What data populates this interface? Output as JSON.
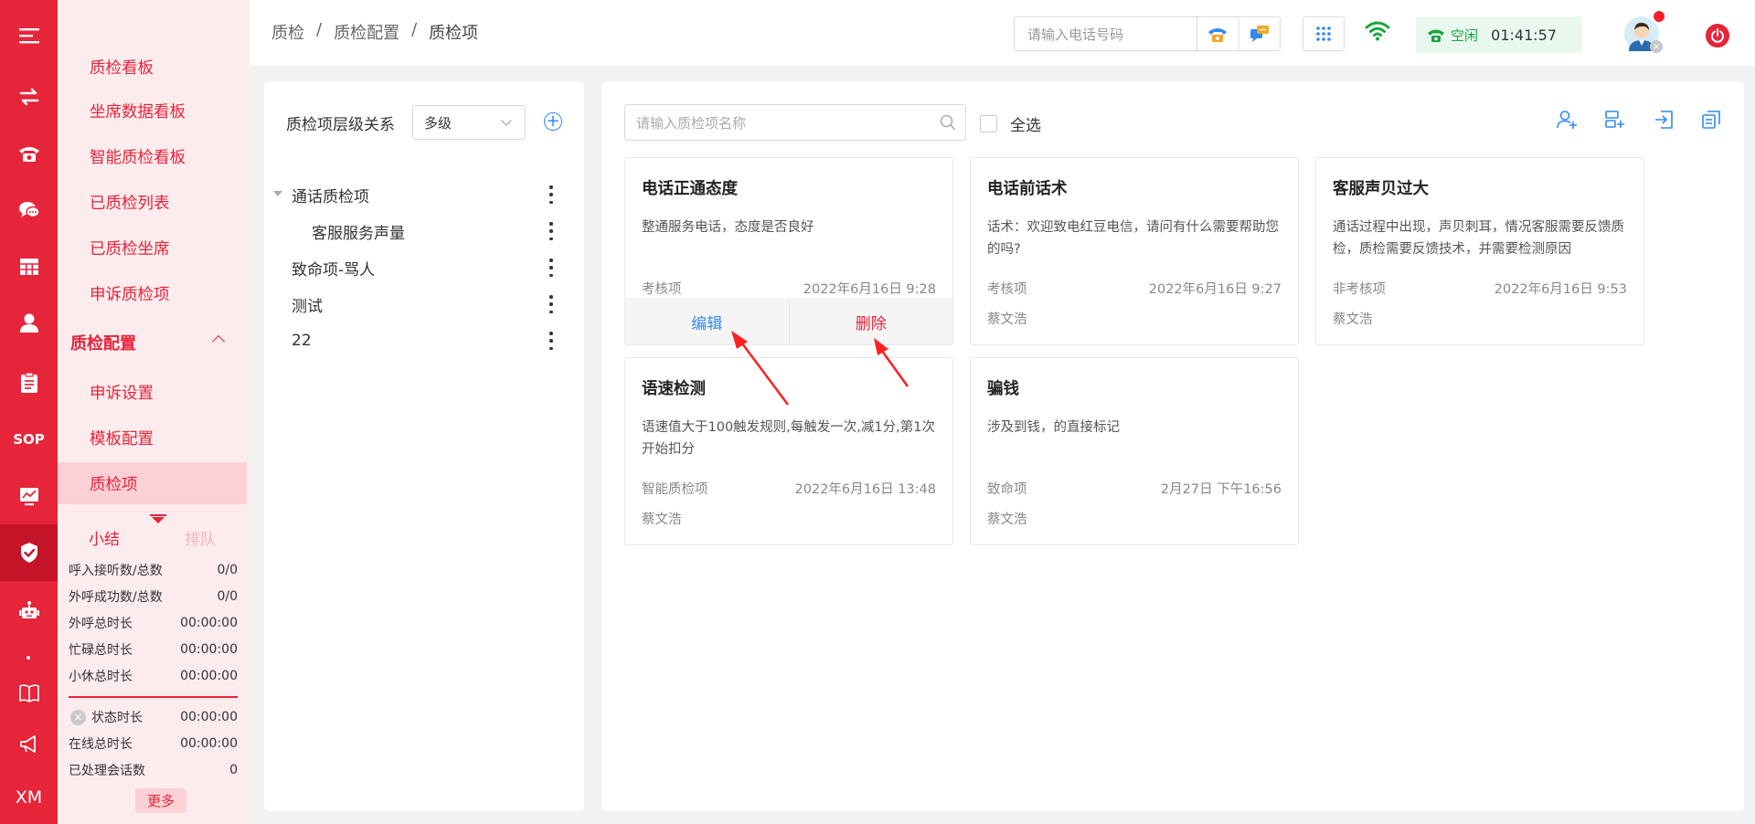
{
  "rail": {
    "sop_label": "SOP",
    "xm_label": "XM",
    "items": [
      {
        "icon": "menu-icon"
      },
      {
        "icon": "transfer-icon"
      },
      {
        "icon": "telephone-icon"
      },
      {
        "icon": "chat-bubbles-icon"
      },
      {
        "icon": "table-grid-icon"
      },
      {
        "icon": "person-icon"
      },
      {
        "icon": "clipboard-icon"
      },
      {
        "icon": "sop-icon"
      },
      {
        "icon": "monitor-chart-icon"
      },
      {
        "icon": "shield-check-icon"
      },
      {
        "icon": "robot-icon"
      },
      {
        "icon": "book-icon"
      },
      {
        "icon": "megaphone-icon"
      },
      {
        "icon": "xm-icon"
      }
    ]
  },
  "submenu": {
    "items": [
      "质检看板",
      "坐席数据看板",
      "智能质检看板",
      "已质检列表",
      "已质检坐席",
      "申诉质检项"
    ],
    "group": "质检配置",
    "group_items": [
      "申诉设置",
      "模板配置",
      "质检项"
    ],
    "active": "质检项"
  },
  "summary": {
    "tab_active": "小结",
    "tab_other": "排队",
    "rows": [
      {
        "label": "呼入接听数/总数",
        "value": "0/0"
      },
      {
        "label": "外呼成功数/总数",
        "value": "0/0"
      },
      {
        "label": "外呼总时长",
        "value": "00:00:00"
      },
      {
        "label": "忙碌总时长",
        "value": "00:00:00"
      },
      {
        "label": "小休总时长",
        "value": "00:00:00"
      }
    ],
    "rows2": [
      {
        "label": "状态时长",
        "value": "00:00:00"
      },
      {
        "label": "在线总时长",
        "value": "00:00:00"
      },
      {
        "label": "已处理会话数",
        "value": "0"
      }
    ],
    "more": "更多"
  },
  "header": {
    "breadcrumb": [
      "质检",
      "质检配置",
      "质检项"
    ],
    "separator": "/",
    "phone_placeholder": "请输入电话号码",
    "status": "空闲",
    "time": "01:41:57"
  },
  "tree": {
    "title": "质检项层级关系",
    "level": "多级",
    "nodes": [
      {
        "label": "通话质检项",
        "level": 0,
        "expanded": true
      },
      {
        "label": "客服服务声量",
        "level": 1
      },
      {
        "label": "致命项-骂人",
        "level": 0
      },
      {
        "label": "测试",
        "level": 0
      },
      {
        "label": "22",
        "level": 0
      }
    ]
  },
  "main": {
    "search_placeholder": "请输入质检项名称",
    "select_all": "全选",
    "edit_label": "编辑",
    "delete_label": "删除",
    "cards": [
      {
        "title": "电话正通态度",
        "desc": "整通服务电话，态度是否良好",
        "type": "考核项",
        "date": "2022年6月16日 9:28",
        "author": ""
      },
      {
        "title": "电话前话术",
        "desc": "话术：欢迎致电红豆电信，请问有什么需要帮助您的吗?",
        "type": "考核项",
        "date": "2022年6月16日 9:27",
        "author": "蔡文浩"
      },
      {
        "title": "客服声贝过大",
        "desc": "通话过程中出现，声贝刺耳，情况客服需要反馈质检，质检需要反馈技术，并需要检测原因",
        "type": "非考核项",
        "date": "2022年6月16日 9:53",
        "author": "蔡文浩"
      },
      {
        "title": "语速检测",
        "desc": "语速值大于100触发规则,每触发一次,减1分,第1次开始扣分",
        "type": "智能质检项",
        "date": "2022年6月16日 13:48",
        "author": "蔡文浩"
      },
      {
        "title": "骗钱",
        "desc": "涉及到钱，的直接标记",
        "type": "致命项",
        "date": "2月27日 下午16:56",
        "author": "蔡文浩"
      }
    ]
  },
  "colors": {
    "brand": "#e6243a",
    "link": "#2f8af5",
    "status_green": "#18a540"
  }
}
